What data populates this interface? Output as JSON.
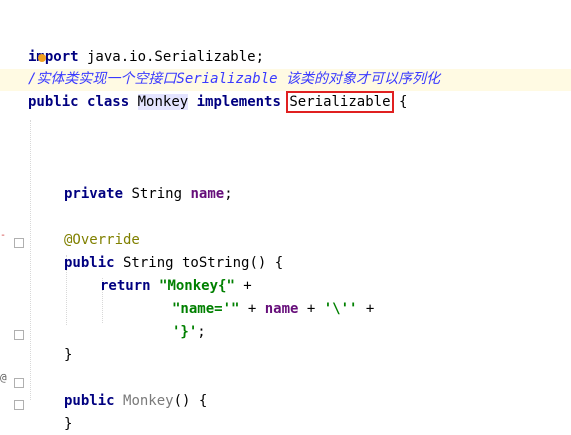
{
  "code": {
    "import_kw": "import",
    "import_path": " java.io.Serializable;",
    "comment_slash": "/",
    "comment_text": "实体类实现一个空接口Serializable 该类的对象才可以序列化",
    "public_kw": "public",
    "class_kw": "class",
    "class_name": "Monkey",
    "implements_kw": "implements",
    "interface_name": "Serializable",
    "brace_open": " {",
    "private_kw": "private",
    "string_type": "String",
    "field_name": "name",
    "semicolon": ";",
    "annotation": "@Override",
    "method_sig": " String toString() {",
    "return_kw": "return",
    "str1": "\"Monkey{\"",
    "plus": " +",
    "str2": "\"name='\"",
    "plus_name": " + ",
    "name_ref": "name",
    "plus2": " + ",
    "str3": "'\\''",
    "plus3": " +",
    "str4": "'}'",
    "semi2": ";",
    "brace_close": "}",
    "ctor_name": "Monkey",
    "ctor_sig": "() {",
    "brace_close2": "}"
  },
  "gutter_marks": {
    "error_mark": "-",
    "at_mark": "@"
  }
}
